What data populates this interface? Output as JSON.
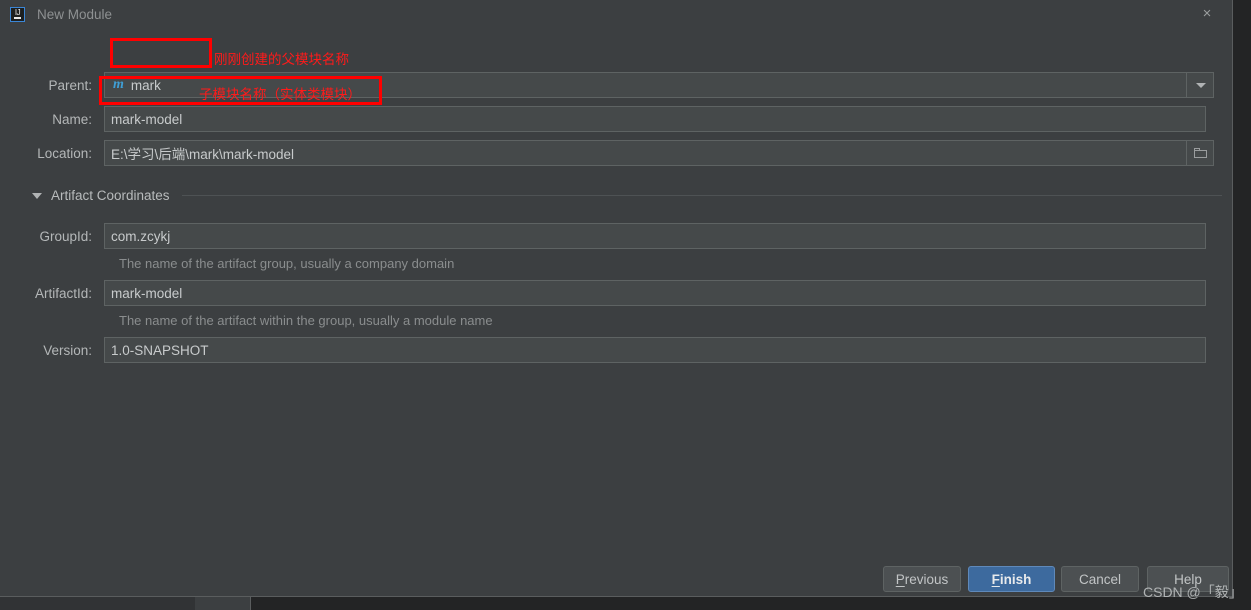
{
  "window": {
    "title": "New Module",
    "app_icon": "intellij-idea-icon",
    "close_label": "×"
  },
  "form": {
    "parent": {
      "label": "Parent:",
      "value": "mark",
      "icon": "maven-module-icon",
      "icon_glyph": "m",
      "dropdown_icon": "chevron-down-icon"
    },
    "name": {
      "label": "Name:",
      "value": "mark-model",
      "placeholder": ""
    },
    "location": {
      "label": "Location:",
      "value": "E:\\学习\\后端\\mark\\mark-model",
      "browse_icon": "folder-icon"
    }
  },
  "artifact_section": {
    "title": "Artifact Coordinates",
    "expanded": true,
    "collapse_icon": "triangle-down-icon",
    "group_id": {
      "label": "GroupId:",
      "value": "com.zcykj",
      "hint": "The name of the artifact group, usually a company domain"
    },
    "artifact_id": {
      "label": "ArtifactId:",
      "value": "mark-model",
      "hint": "The name of the artifact within the group, usually a module name"
    },
    "version": {
      "label": "Version:",
      "value": "1.0-SNAPSHOT"
    }
  },
  "buttons": {
    "previous": "Previous",
    "previous_mnemonic": "P",
    "previous_rest": "revious",
    "finish": "Finish",
    "finish_mnemonic": "F",
    "finish_rest": "inish",
    "cancel": "Cancel",
    "help": "Help"
  },
  "annotations": {
    "parent_note": "刚刚创建的父模块名称",
    "name_note": "子模块名称（实体类模块）",
    "box_color": "#ff0000"
  },
  "watermark": {
    "text": "CSDN @「毅」"
  },
  "colors": {
    "dialog_bg": "#3c3f41",
    "field_bg": "#45494a",
    "accent_blue": "#3d6a9e",
    "maven_icon_blue": "#3f9fd6",
    "annotation_red": "#ff0000"
  }
}
